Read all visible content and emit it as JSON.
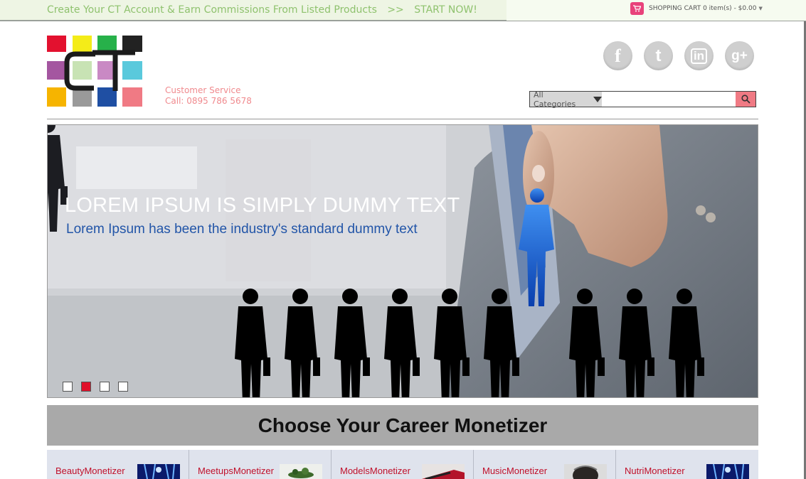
{
  "topbar": {
    "promo_text": "Create Your CT Account & Earn Commissions From Listed Products",
    "promo_arrows": ">>",
    "promo_cta": "START NOW!",
    "cart_label": "SHOPPING CART",
    "cart_count": "0 item(s)",
    "cart_total": "- $0.00"
  },
  "logo": {
    "text": "CT"
  },
  "customer_service": {
    "label": "Customer Service",
    "phone": "Call:  0895 786 5678"
  },
  "social": [
    {
      "icon": "facebook-icon",
      "glyph": "f"
    },
    {
      "icon": "twitter-icon",
      "glyph": "t"
    },
    {
      "icon": "linkedin-icon",
      "glyph": "in"
    },
    {
      "icon": "google-plus-icon",
      "glyph": "g+"
    }
  ],
  "search": {
    "category": "All Categories",
    "placeholder": ""
  },
  "hero": {
    "title": "LOREM IPSUM IS SIMPLY DUMMY TEXT",
    "subtitle": "Lorem Ipsum has been the industry's standard dummy text",
    "slides": 4,
    "active_slide": 2
  },
  "career": {
    "heading": "Choose Your Career Monetizer"
  },
  "categories": [
    {
      "label": "BeautyMonetizer"
    },
    {
      "label": "MeetupsMonetizer"
    },
    {
      "label": "ModelsMonetizer"
    },
    {
      "label": "MusicMonetizer"
    },
    {
      "label": "NutriMonetizer"
    }
  ],
  "colors": {
    "promo": "#8fc26e",
    "cart_icon": "#e8427a",
    "search_button": "#f07a84",
    "hero_subtitle": "#2255a8",
    "category_label": "#c0102a",
    "active_dot": "#e0102a"
  }
}
